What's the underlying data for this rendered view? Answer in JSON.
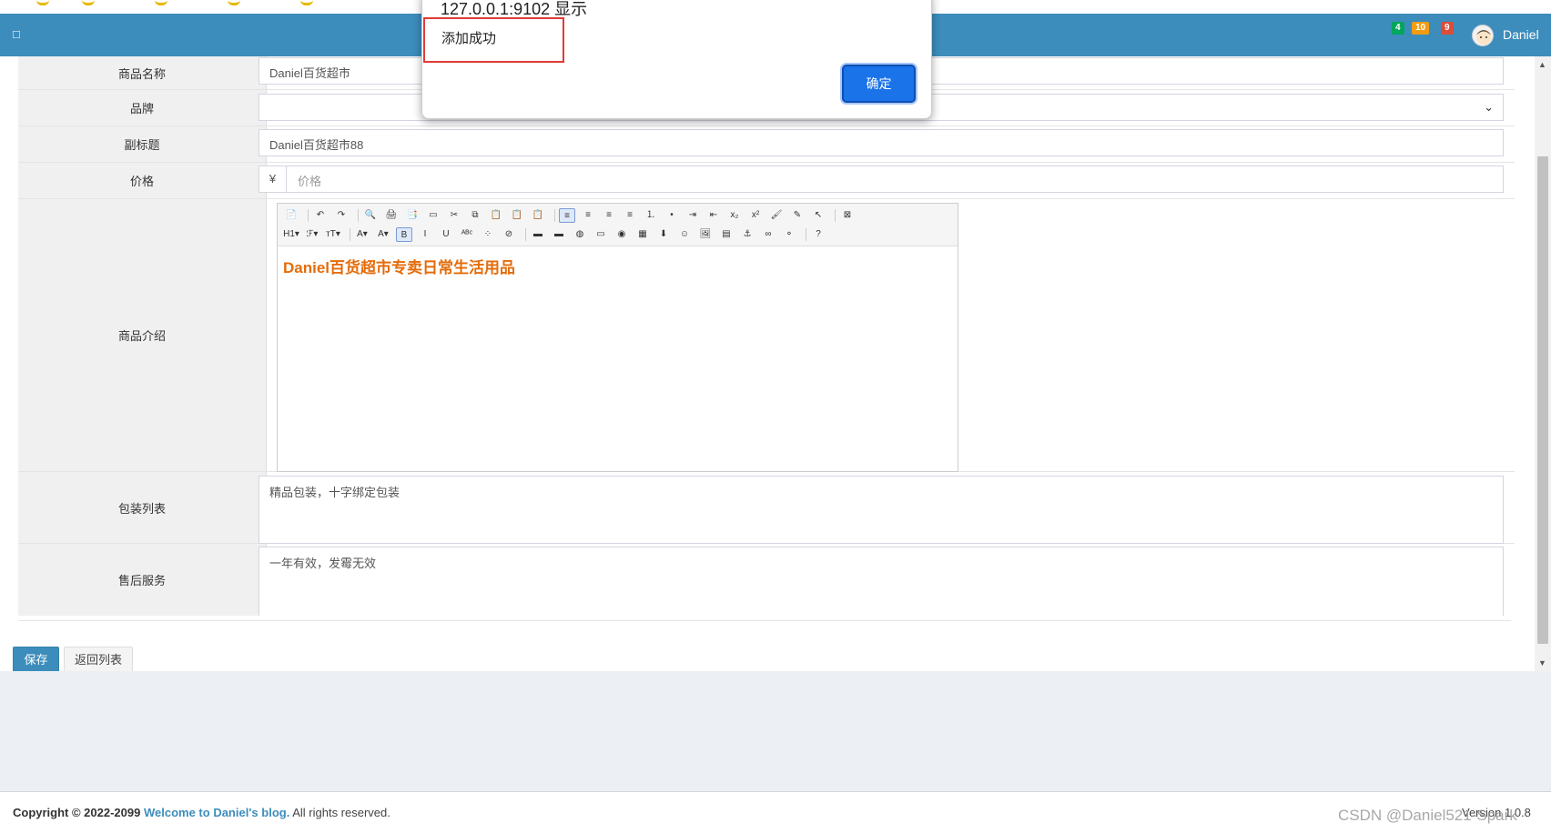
{
  "header": {
    "toggle_icon": "□",
    "badges": [
      {
        "value": "4",
        "color": "#00a65a"
      },
      {
        "value": "10",
        "color": "#f39c12"
      },
      {
        "value": "9",
        "color": "#dd4b39"
      }
    ],
    "user_name": "Daniel"
  },
  "form": {
    "name_label": "商品名称",
    "name_value": "Daniel百货超市",
    "brand_label": "品牌",
    "brand_value": "",
    "subtitle_label": "副标题",
    "subtitle_value": "Daniel百货超市88",
    "price_label": "价格",
    "price_addon": "¥",
    "price_placeholder": "价格",
    "intro_label": "商品介绍",
    "intro_content": "Daniel百货超市专卖日常生活用品",
    "package_label": "包装列表",
    "package_value": "精品包装，十字绑定包装",
    "service_label": "售后服务",
    "service_value": "一年有效，发霉无效"
  },
  "editor_toolbar": {
    "row1": [
      "📄",
      "|",
      "↶",
      "↷",
      "|",
      "🔍",
      "🖨",
      "📑",
      "▭",
      "✂",
      "⧉",
      "📋",
      "📋",
      "📋",
      "|",
      "≡",
      "≡",
      "≡",
      "≡",
      "⒈",
      "•",
      "⇥",
      "⇤",
      "x₂",
      "x²",
      "🖌",
      "✎",
      "↖",
      "|",
      "⊠"
    ],
    "row2": [
      "H1▾",
      "ℱ▾",
      "ᴛT▾",
      "|",
      "A▾",
      "A▾",
      "B",
      "I",
      "U",
      "ᴬᴮᶜ",
      "⁘",
      "⊘",
      "|",
      "▬",
      "▬",
      "◍",
      "▭",
      "◉",
      "▦",
      "⬇",
      "☺",
      "🖼",
      "▤",
      "⚓",
      "∞",
      "⚬",
      "|",
      "?"
    ]
  },
  "buttons": {
    "save": "保存",
    "back": "返回列表"
  },
  "dialog": {
    "origin": "127.0.0.1:9102 显示",
    "message": "添加成功",
    "ok": "确定"
  },
  "footer": {
    "copyright_prefix": "Copyright © 2022-2099",
    "link_text": "Welcome to Daniel's blog.",
    "rights": "All rights reserved.",
    "version": "Version 1.0.8",
    "watermark": "CSDN @Daniel521-Spark"
  }
}
